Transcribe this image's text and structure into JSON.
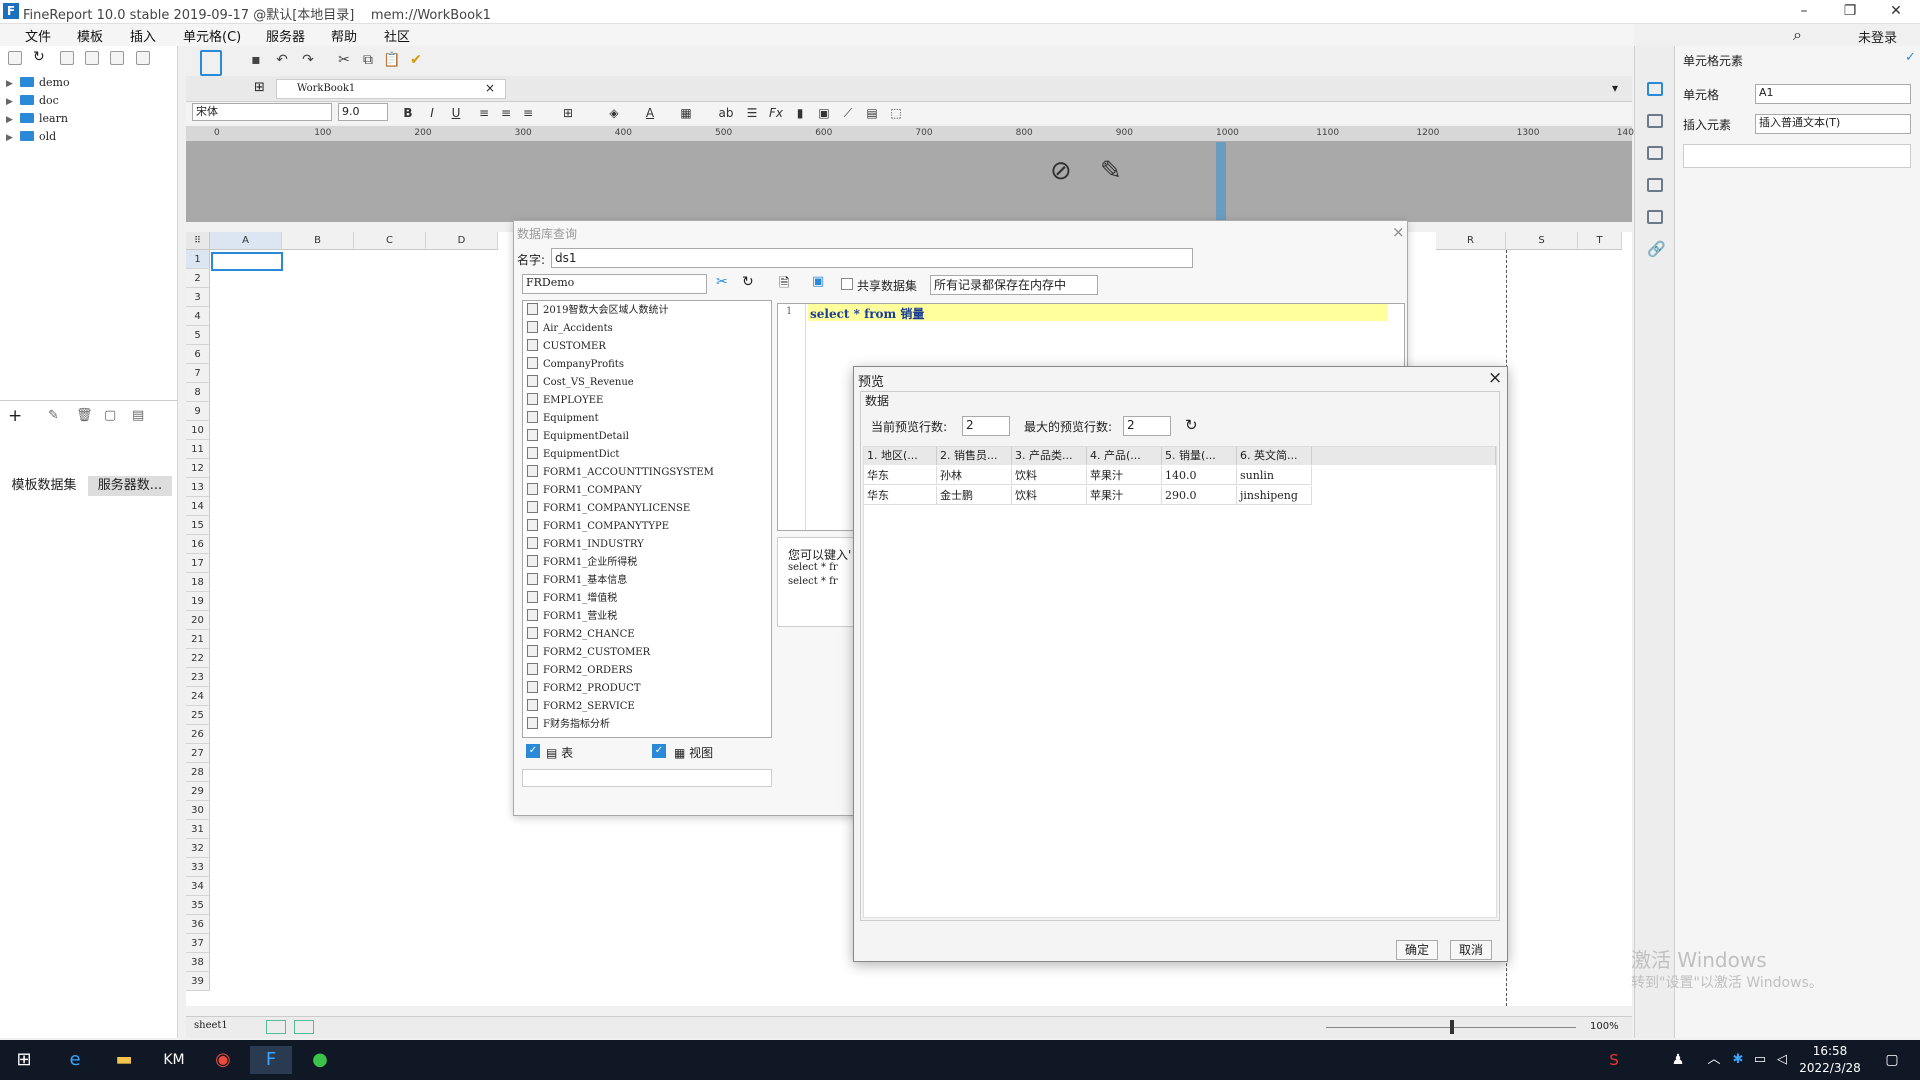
{
  "window": {
    "title": "FineReport 10.0 stable 2019-09-17 @默认[本地目录]",
    "path": "mem://WorkBook1",
    "logo": "F",
    "minimize": "–",
    "restore": "❐",
    "close": "✕"
  },
  "menu": [
    "文件",
    "模板",
    "插入",
    "单元格(C)",
    "服务器",
    "帮助",
    "社区"
  ],
  "login": "未登录",
  "tree": [
    "demo",
    "doc",
    "learn",
    "old"
  ],
  "dataset_tabs": [
    "模板数据集",
    "服务器数..."
  ],
  "doc_tab": "WorkBook1",
  "format": {
    "font": "宋体",
    "size": "9.0"
  },
  "ruler": [
    "0",
    "100",
    "200",
    "300",
    "400",
    "500",
    "600",
    "700",
    "800",
    "900",
    "1000",
    "1100",
    "1200",
    "1300",
    "140"
  ],
  "columns": [
    "A",
    "B",
    "C",
    "D",
    "R",
    "S",
    "T"
  ],
  "rows": [
    "1",
    "2",
    "3",
    "4",
    "5",
    "6",
    "7",
    "8",
    "9",
    "10",
    "11",
    "12",
    "13",
    "14",
    "15",
    "16",
    "17",
    "18",
    "19",
    "20",
    "21",
    "22",
    "23",
    "24",
    "25",
    "26",
    "27",
    "28",
    "29",
    "30",
    "31",
    "32",
    "33",
    "34",
    "35",
    "36",
    "37",
    "38",
    "39"
  ],
  "sheet": {
    "name": "sheet1",
    "zoom": "100%"
  },
  "rightpanel": {
    "title": "单元格元素",
    "cell_label": "单元格",
    "cell_value": "A1",
    "insert_label": "插入元素",
    "insert_value": "插入普通文本(T)"
  },
  "db_dialog": {
    "title": "数据库查询",
    "name_label": "名字:",
    "name_value": "ds1",
    "connection": "FRDemo",
    "share_label": "共享数据集",
    "memory_option": "所有记录都保存在内存中",
    "sql_line": "1",
    "sql": "select * from 销量",
    "hint": "您可以键入'",
    "hint2": "select * fr",
    "hint3": "select * fr",
    "tables": [
      "2019智数大会区域人数统计",
      "Air_Accidents",
      "CUSTOMER",
      "CompanyProfits",
      "Cost_VS_Revenue",
      "EMPLOYEE",
      "Equipment",
      "EquipmentDetail",
      "EquipmentDict",
      "FORM1_ACCOUNTTINGSYSTEM",
      "FORM1_COMPANY",
      "FORM1_COMPANYLICENSE",
      "FORM1_COMPANYTYPE",
      "FORM1_INDUSTRY",
      "FORM1_企业所得税",
      "FORM1_基本信息",
      "FORM1_增值税",
      "FORM1_营业税",
      "FORM2_CHANCE",
      "FORM2_CUSTOMER",
      "FORM2_ORDERS",
      "FORM2_PRODUCT",
      "FORM2_SERVICE",
      "F财务指标分析"
    ],
    "table_check": "表",
    "view_check": "视图"
  },
  "preview": {
    "title": "预览",
    "section": "数据",
    "current_label": "当前预览行数:",
    "current_value": "2",
    "max_label": "最大的预览行数:",
    "max_value": "2",
    "headers": [
      "1. 地区(...",
      "2. 销售员...",
      "3. 产品类...",
      "4. 产品(...",
      "5. 销量(...",
      "6. 英文简..."
    ],
    "rows": [
      [
        "华东",
        "孙林",
        "饮料",
        "苹果汁",
        "140.0",
        "sunlin"
      ],
      [
        "华东",
        "金士鹏",
        "饮料",
        "苹果汁",
        "290.0",
        "jinshipeng"
      ]
    ],
    "ok": "确定",
    "cancel": "取消"
  },
  "watermark": {
    "line1": "激活 Windows",
    "line2": "转到\"设置\"以激活 Windows。"
  },
  "clock": {
    "time": "16:58",
    "date": "2022/3/28"
  },
  "accent_color": "#2b8ad8"
}
